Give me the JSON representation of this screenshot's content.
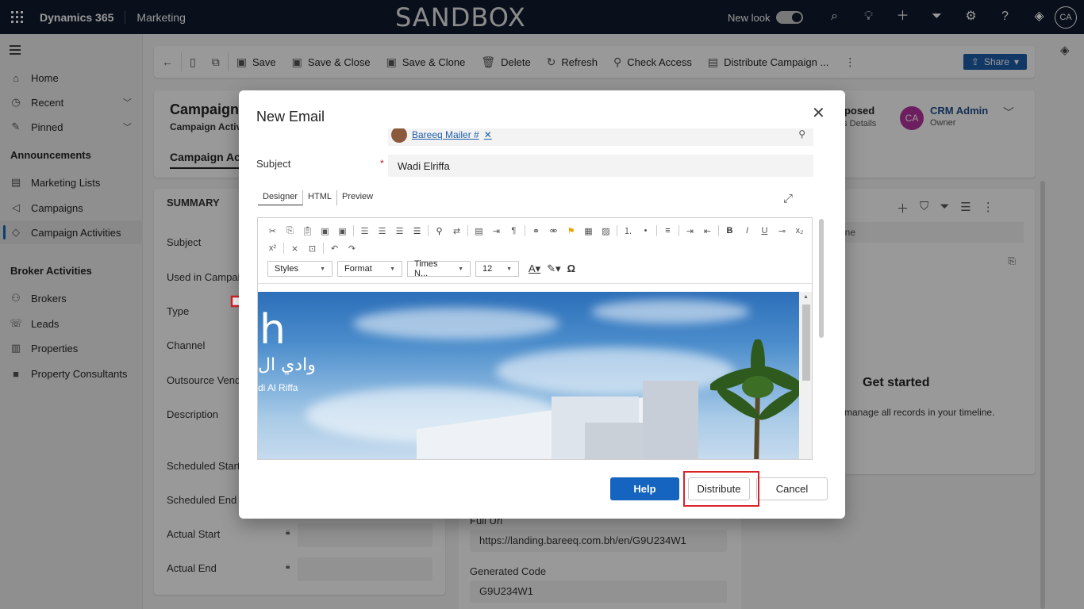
{
  "topbar": {
    "brand": "Dynamics 365",
    "app": "Marketing",
    "environment": "SANDBOX",
    "new_look_label": "New look",
    "avatar_initials": "CA"
  },
  "sidebar": {
    "items": [
      {
        "label": "Home",
        "icon": "home-icon"
      },
      {
        "label": "Recent",
        "icon": "clock-icon"
      },
      {
        "label": "Pinned",
        "icon": "pin-icon"
      }
    ],
    "section_announcements": "Announcements",
    "announcements": [
      {
        "label": "Marketing Lists"
      },
      {
        "label": "Campaigns"
      },
      {
        "label": "Campaign Activities"
      }
    ],
    "section_broker": "Broker Activities",
    "broker": [
      {
        "label": "Brokers"
      },
      {
        "label": "Leads"
      },
      {
        "label": "Properties"
      },
      {
        "label": "Property Consultants"
      }
    ]
  },
  "commandbar": {
    "save": "Save",
    "save_close": "Save & Close",
    "save_clone": "Save & Clone",
    "delete": "Delete",
    "refresh": "Refresh",
    "check_access": "Check Access",
    "distribute": "Distribute Campaign ...",
    "share": "Share"
  },
  "record": {
    "title": "Campaign",
    "subtitle": "Campaign Activi",
    "tab": "Campaign Ac",
    "status": "oposed",
    "status_sub": "us Details",
    "owner_initials": "CA",
    "owner_name": "CRM Admin",
    "owner_label": "Owner"
  },
  "summary": {
    "title": "SUMMARY",
    "labels": [
      "Subject",
      "Used in Campaig",
      "Type",
      "Channel",
      "Outsource Vendo",
      "Description",
      "Scheduled Start",
      "Scheduled End",
      "Actual Start",
      "Actual End"
    ]
  },
  "middle": {
    "full_url_label": "Full Url",
    "full_url_value": "https://landing.bareeq.com.bh/en/G9U234W1",
    "generated_code_label": "Generated Code",
    "generated_code_value": "G9U234W1"
  },
  "timeline": {
    "search_placeholder": "ine",
    "row_text": "...",
    "get_started": "Get started",
    "sub": "manage all records in your timeline."
  },
  "dialog": {
    "title": "New Email",
    "recipient": "Bareeq Mailer #",
    "subject_label": "Subject",
    "subject_required": "*",
    "subject_value": "Wadi Elriffa",
    "tabs": [
      "Designer",
      "HTML",
      "Preview"
    ],
    "toolbar_combos": {
      "styles": "Styles",
      "format": "Format",
      "font": "Times N...",
      "size": "12"
    },
    "image": {
      "logo_letter": "h",
      "logo_arabic": "وادي ال",
      "logo_english": "di Al Riffa"
    },
    "buttons": {
      "help": "Help",
      "distribute": "Distribute",
      "cancel": "Cancel"
    }
  }
}
